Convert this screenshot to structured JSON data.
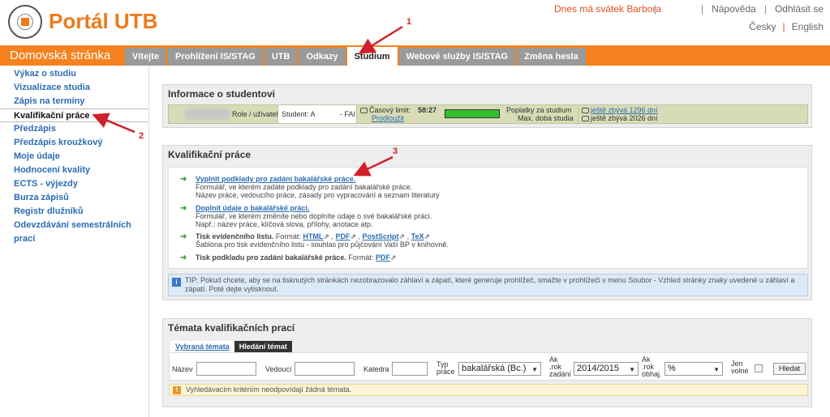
{
  "header": {
    "brand": "Portál UTB",
    "nameday": "Dnes má svátek Barbora",
    "help": "Nápověda",
    "logout": "Odhlásit se",
    "lang_cz": "Česky",
    "lang_en": "English"
  },
  "nav": {
    "home_title": "Domovská stránka",
    "tabs": [
      "Vítejte",
      "Prohlížení IS/STAG",
      "UTB",
      "Odkazy",
      "Studium",
      "Webové služby IS/STAG",
      "Změna hesla"
    ],
    "active_tab": "Studium"
  },
  "sidebar": {
    "items": [
      "Výkaz o studiu",
      "Vizualizace studia",
      "Zápis na termíny",
      "Kvalifikační práce",
      "Předzápis",
      "Předzápis kroužkový",
      "Moje údaje",
      "Hodnocení kvality",
      "ECTS - výjezdy",
      "Burza zápisů",
      "Registr dlužníků",
      "Odevzdávání semestrálních prací"
    ],
    "active": "Kvalifikační práce"
  },
  "student_info": {
    "title": "Informace o studentovi",
    "role_label": "Role / uživatel",
    "student_value": "Student: A",
    "faculty": "- FAI",
    "time_limit_label": "Časový limit:",
    "time_limit_value": "58:27",
    "extend": "Prodloužit",
    "fees_label": "Poplatky za studium",
    "max_label": "Max. doba studia",
    "fees_remaining": "ještě zbývá 1296 dní",
    "max_remaining": "ještě zbývá 2026 dní"
  },
  "kval": {
    "title": "Kvalifikační práce",
    "items": [
      {
        "link": "Vyplnit podklady pro zadání bakalářské práce.",
        "l1": "Formulář, ve kterém zadáte podklady pro zadání bakalářské práce.",
        "l2": "Název práce, vedoucího práce, zásady pro vypracování a seznam literatury"
      },
      {
        "link": "Doplnit údaje o bakalářské práci.",
        "l1": "Formulář, ve kterém změníte nebo doplníte údaje o své bakalářské práci.",
        "l2": "Např.: název práce, klíčová slova, přílohy, anotace atp."
      }
    ],
    "print1_label": "Tisk evidenčního listu.",
    "print1_format": "Formát:",
    "print1_f1": "HTML",
    "print1_f2": "PDF",
    "print1_f3": "PostScript",
    "print1_f4": "TeX",
    "print1_desc": "Šablona pro tisk evidenčního listu - souhlas pro půjčování Vaší BP v knihovně.",
    "print2_label": "Tisk podkladu pro zadání bakalářské práce.",
    "print2_format": "Formát:",
    "print2_f1": "PDF",
    "tip_line1": "TIP: Pokud chcete, aby se na tisknutých stránkách nezobrazovalo záhlaví a zápatí, které generuje prohlížeč, smažte v prohlížeči v menu Soubor - Vzhled stránky znaky uvedené u záhlaví a",
    "tip_line2": "zápatí. Poté dejte vytisknout."
  },
  "topics": {
    "title": "Témata kvalifikačních prací",
    "tab1": "Vybraná témata",
    "tab2": "Hledání témat",
    "name_label": "Název",
    "supervisor_label": "Vedoucí",
    "dept_label": "Katedra",
    "type_label_1": "Typ",
    "type_label_2": "práce",
    "type_value": "bakalářská (Bc.)",
    "year_label_1": "Ak",
    "year_label_2": ".rok",
    "year_label_3": "zadání",
    "year_value": "2014/2015",
    "year2_label_1": "Ak",
    "year2_label_2": ".rok",
    "year2_label_3": "obhaj.",
    "year2_value": "%",
    "free_label_1": "Jen",
    "free_label_2": "volné",
    "search_button": "Hledat",
    "warning": "Vyhledávacím kritériím neodpovídají žádná témata."
  },
  "annotations": [
    "1",
    "2",
    "3"
  ],
  "colors": {
    "accent": "#f5821f",
    "link": "#2b6cb3",
    "annotation": "#d0202a"
  }
}
